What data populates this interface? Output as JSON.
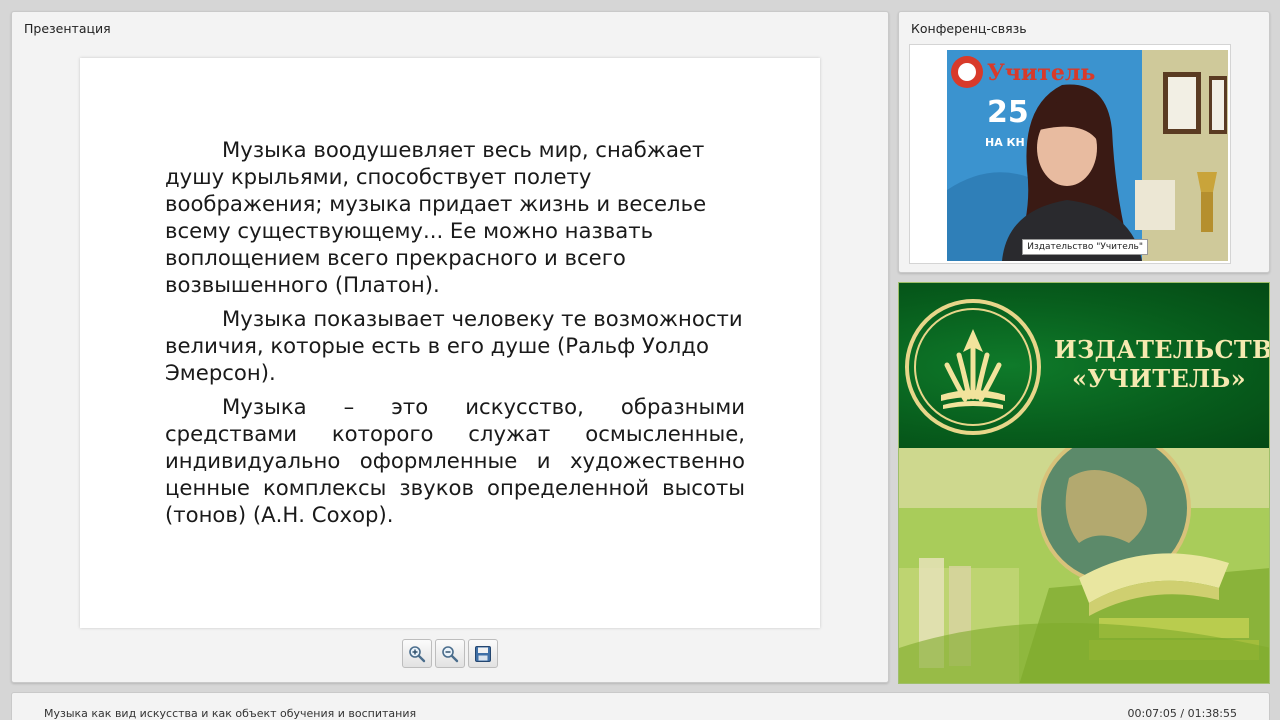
{
  "presentation": {
    "title": "Презентация",
    "slide": {
      "paragraphs": [
        "Музыка воодушевляет весь мир, снабжает душу крыльями, способствует полету воображения; музыка придает жизнь и веселье всему существующему... Ее можно назвать воплощением всего прекрасного и всего возвышенного (Платон).",
        "Музыка показывает человеку те возможности величия, которые есть в его душе (Ральф Уолдо Эмерсон).",
        "Музыка – это искусство, образными средствами которого служат осмысленные, индивидуально оформленные и художественно ценные комплексы звуков определенной высоты (тонов) (А.Н. Сохор)."
      ]
    },
    "toolbar": {
      "zoom_in_icon": "zoom-in-icon",
      "zoom_out_icon": "zoom-out-icon",
      "save_icon": "save-icon"
    }
  },
  "conference": {
    "title": "Конференц-связь",
    "participant_caption": "Издательство \"Учитель\"",
    "backdrop_logo_text": "Учитель",
    "backdrop_number": "25",
    "backdrop_sub": "НА КН"
  },
  "banner": {
    "line1": "ИЗДАТЕЛЬСТВО",
    "line2": "«УЧИТЕЛЬ»",
    "colors": {
      "green": "#075c1c",
      "gold": "#f6e9b0"
    }
  },
  "footer": {
    "lecture_title": "Музыка как вид искусства и как объект обучения и воспитания",
    "time": "00:07:05 / 01:38:55"
  }
}
